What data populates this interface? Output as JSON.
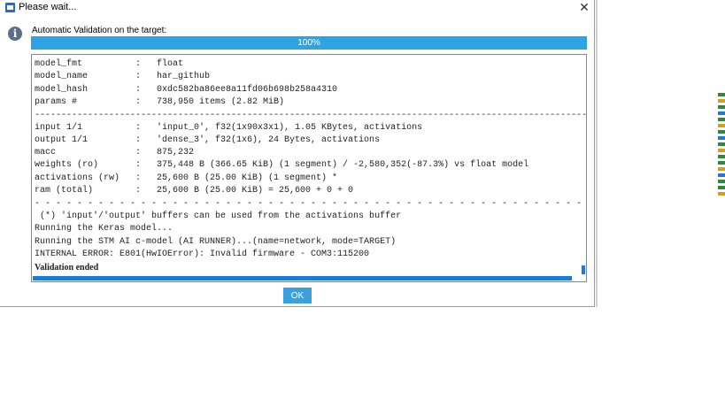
{
  "window": {
    "title": "Please wait...",
    "close_glyph": "✕"
  },
  "message": "Automatic Validation on the target:",
  "progress": {
    "value": 100,
    "label": "100%"
  },
  "log": {
    "lines": [
      {
        "text": "model_fmt          :   float",
        "bold": false
      },
      {
        "text": "model_name         :   har_github",
        "bold": false
      },
      {
        "text": "model_hash         :   0xdc582ba86ee8a11fd06b698b258a4310",
        "bold": false
      },
      {
        "text": "params #           :   738,950 items (2.82 MiB)",
        "bold": false
      },
      {
        "text": "----------------------------------------------------------------------------------------------------------------",
        "bold": false
      },
      {
        "text": "input 1/1          :   'input_0', f32(1x90x3x1), 1.05 KBytes, activations",
        "bold": false
      },
      {
        "text": "output 1/1         :   'dense_3', f32(1x6), 24 Bytes, activations",
        "bold": false
      },
      {
        "text": "macc               :   875,232",
        "bold": false
      },
      {
        "text": "weights (ro)       :   375,448 B (366.65 KiB) (1 segment) / -2,580,352(-87.3%) vs float model",
        "bold": false
      },
      {
        "text": "activations (rw)   :   25,600 B (25.00 KiB) (1 segment) *",
        "bold": false
      },
      {
        "text": "ram (total)        :   25,600 B (25.00 KiB) = 25,600 + 0 + 0",
        "bold": false
      },
      {
        "text": "- - - - - - - - - - - - - - - - - - - - - - - - - - - - - - - - - - - - - - - - - - - - - - - - - - - - - - - - -",
        "bold": false
      },
      {
        "text": " (*) 'input'/'output' buffers can be used from the activations buffer",
        "bold": false
      },
      {
        "text": "Running the Keras model...",
        "bold": false
      },
      {
        "text": "Running the STM AI c-model (AI RUNNER)...(name=network, mode=TARGET)",
        "bold": false
      },
      {
        "text": "INTERNAL ERROR: E801(HwIOError): Invalid firmware - COM3:115200",
        "bold": false
      },
      {
        "text": "Validation ended",
        "bold": true
      }
    ]
  },
  "buttons": {
    "ok_label": "OK"
  },
  "colors": {
    "accent": "#1e9ad8",
    "button": "#3aa1dc",
    "info_icon": "#5a6e88"
  },
  "icons": {
    "app": "app-icon",
    "info": "info-icon",
    "close": "close-icon"
  }
}
